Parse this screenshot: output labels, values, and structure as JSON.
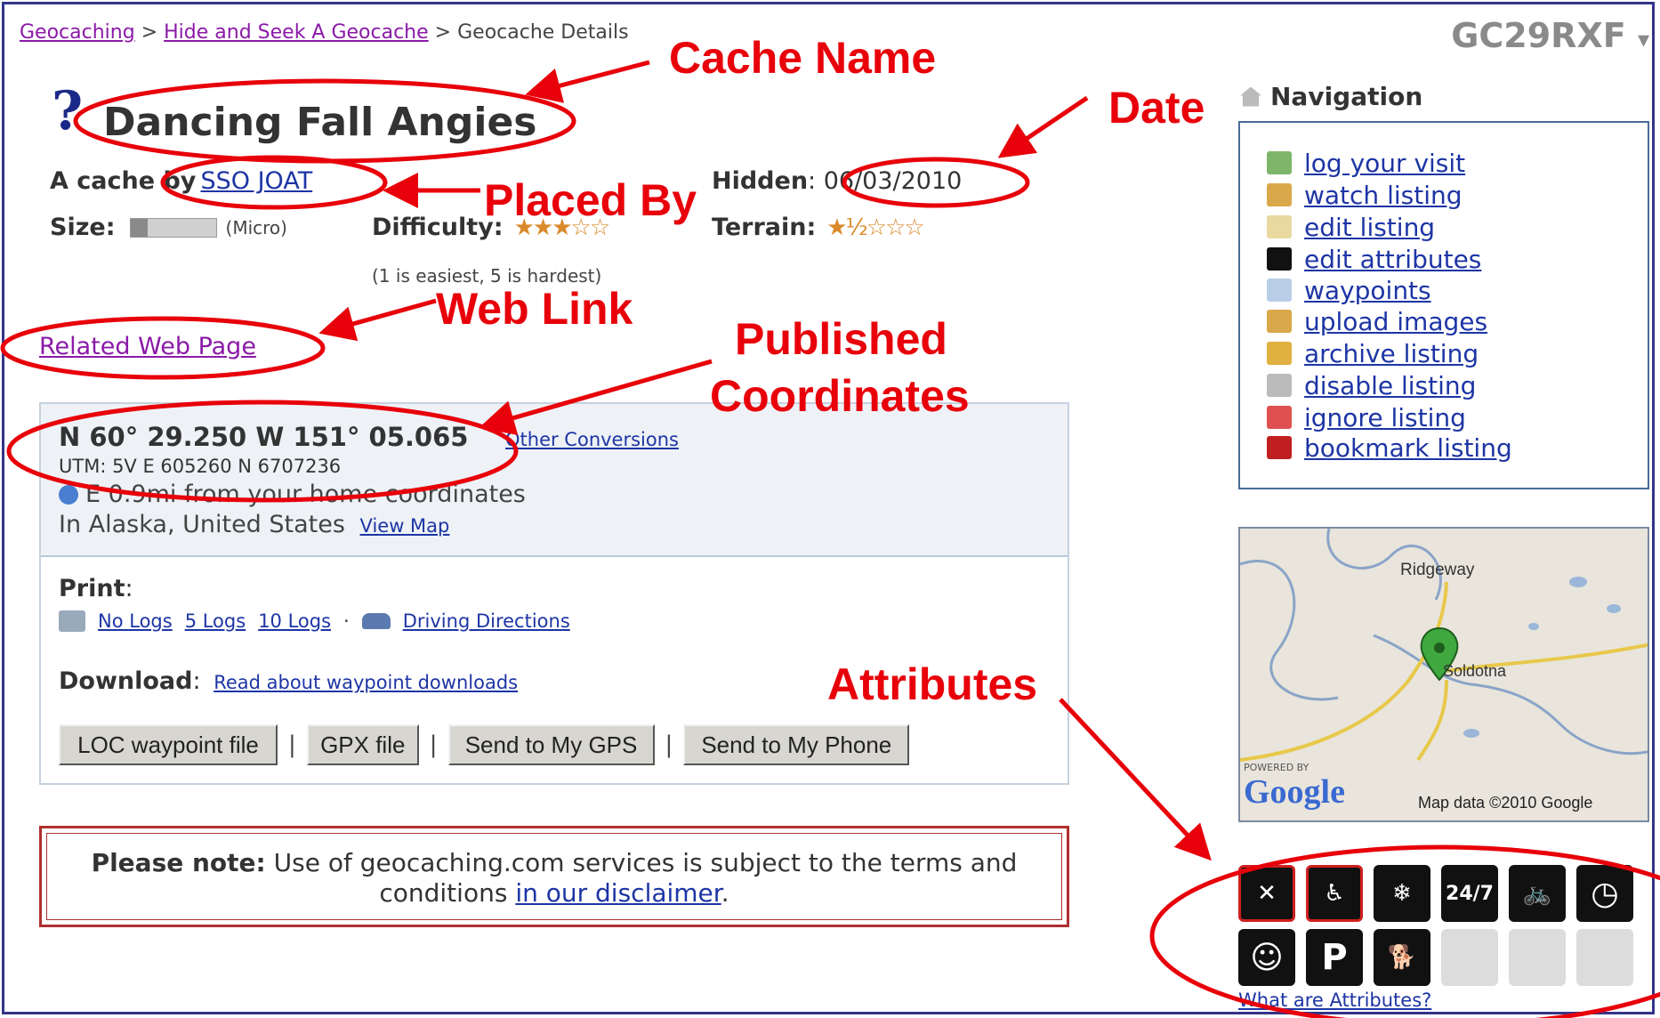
{
  "breadcrumb": {
    "root": "Geocaching",
    "sep1": ">",
    "middle": "Hide and Seek A Geocache",
    "sep2": ">",
    "current": "Geocache Details"
  },
  "gc_code": "GC29RXF",
  "gc_dropdown": "▾",
  "cache": {
    "name": "Dancing Fall Angies",
    "placed_prefix": "A cache by",
    "owner": "SSO JOAT",
    "hidden_label": "Hidden",
    "hidden_date": ": 06/03/2010",
    "size_label": "Size:",
    "size_value": "(Micro)",
    "difficulty_label": "Difficulty:",
    "difficulty_stars": "★★★☆☆",
    "terrain_label": "Terrain:",
    "terrain_stars": "★½☆☆☆",
    "rating_note": "(1 is easiest, 5 is hardest)",
    "related_link": "Related Web Page"
  },
  "coords": {
    "main": "N 60° 29.250 W 151° 05.065",
    "other": "Other Conversions",
    "utm": "UTM: 5V E 605260 N 6707236",
    "distance": "E 0.9mi from your home coordinates",
    "location": "In Alaska, United States",
    "view_map": "View Map"
  },
  "print": {
    "label": "Print",
    "colon": ":",
    "no_logs": "No Logs",
    "five_logs": "5 Logs",
    "ten_logs": "10 Logs",
    "dot": "·",
    "driving": "Driving Directions"
  },
  "download": {
    "label": "Download",
    "colon": ":",
    "link": "Read about waypoint downloads"
  },
  "buttons": {
    "loc": "LOC waypoint file",
    "gpx": "GPX file",
    "gps": "Send to My GPS",
    "phone": "Send to My Phone",
    "sep": "|"
  },
  "note": {
    "bold": "Please note:",
    "text1": "Use of geocaching.com services is subject to the terms and conditions",
    "link": "in our disclaimer",
    "end": "."
  },
  "navigation": {
    "title": "Navigation",
    "items": [
      {
        "label": "log your visit",
        "icon": "log-icon",
        "color": "#7fb56a"
      },
      {
        "label": "watch listing",
        "icon": "watch-icon",
        "color": "#d9a84a"
      },
      {
        "label": "edit listing",
        "icon": "edit-icon",
        "color": "#e8d9a0"
      },
      {
        "label": "edit attributes",
        "icon": "attributes-icon",
        "color": "#111111"
      },
      {
        "label": "waypoints",
        "icon": "waypoints-icon",
        "color": "#b9cfe8"
      },
      {
        "label": "upload images",
        "icon": "upload-icon",
        "color": "#d9a84a"
      },
      {
        "label": "archive listing",
        "icon": "archive-icon",
        "color": "#e0b040"
      },
      {
        "label": "disable listing",
        "icon": "disable-icon",
        "color": "#bbbbbb"
      },
      {
        "label": "ignore listing",
        "icon": "ignore-icon",
        "color": "#e05050"
      },
      {
        "label": "bookmark listing",
        "icon": "bookmark-icon",
        "color": "#c02020"
      }
    ]
  },
  "map": {
    "place1": "Ridgeway",
    "place2": "Soldotna",
    "powered": "POWERED BY",
    "brand": "Google",
    "copyright": "Map data ©2010 Google"
  },
  "attributes": {
    "items": [
      {
        "icon": "no-kids-icon",
        "text": "✕"
      },
      {
        "icon": "no-wheelchair-icon",
        "text": "♿"
      },
      {
        "icon": "winter-icon",
        "text": "❄"
      },
      {
        "icon": "available-24-7-icon",
        "text": "24/7"
      },
      {
        "icon": "bicycles-icon",
        "text": "🚲"
      },
      {
        "icon": "takes-less-than-hour-icon",
        "text": "◷"
      },
      {
        "icon": "kid-friendly-icon",
        "text": "☺"
      },
      {
        "icon": "parking-icon",
        "text": "P"
      },
      {
        "icon": "dogs-icon",
        "text": "🐕"
      }
    ],
    "link": "What are Attributes?"
  },
  "annotations": {
    "cache_name": "Cache Name",
    "date": "Date",
    "placed_by": "Placed By",
    "web_link": "Web Link",
    "published_1": "Published",
    "published_2": "Coordinates",
    "attributes": "Attributes"
  },
  "colors": {
    "annotation_red": "#e8000a",
    "link_blue": "#1d35a5",
    "visited_purple": "#8a1aa8",
    "frame": "#34348a"
  }
}
